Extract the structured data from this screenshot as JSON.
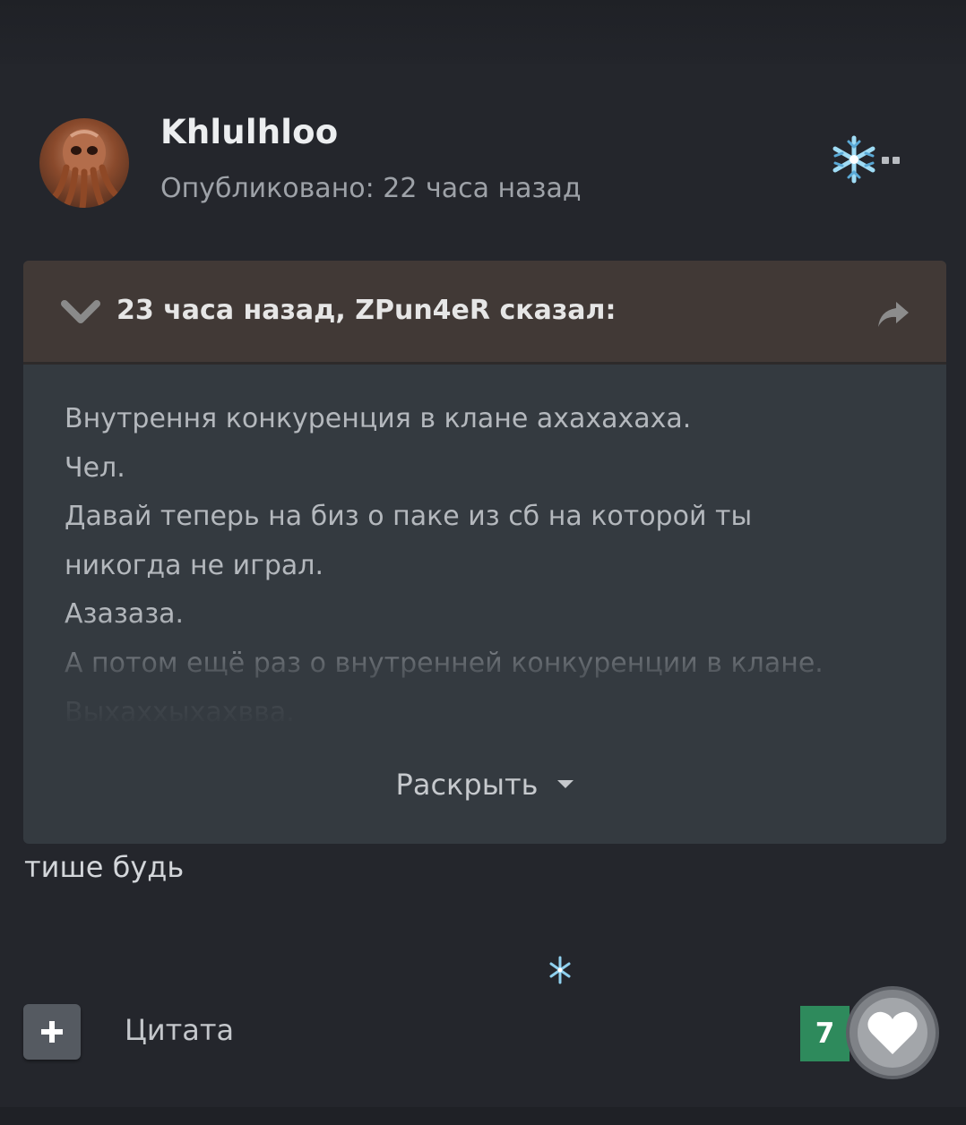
{
  "post": {
    "author": "Khlulhloo",
    "published": "Опубликовано: 22 часа назад"
  },
  "quote": {
    "citation": "23 часа назад, ZPun4eR сказал:",
    "lines": [
      "Внутрення конкуренция в клане ахахахаха.",
      "Чел.",
      "Давай теперь на биз о паке из сб на которой ты",
      "никогда не играл.",
      "Азазаза.",
      "А потом ещё раз о внутренней конкуренции в клане.",
      "Выхаххыхахвва."
    ],
    "expand_label": "Раскрыть"
  },
  "reply": {
    "text": "тише будь"
  },
  "footer": {
    "quote_label": "Цитата",
    "like_count": "7"
  },
  "icons": {
    "collapse": "chevron-down-icon",
    "share": "share-arrow-icon",
    "add": "plus-icon",
    "like": "heart-icon",
    "decor": "snowflake-icon"
  },
  "colors": {
    "background": "#24262c",
    "quote_header": "#413936",
    "quote_body": "#343a40",
    "like_count_badge": "#2e8a5c"
  }
}
